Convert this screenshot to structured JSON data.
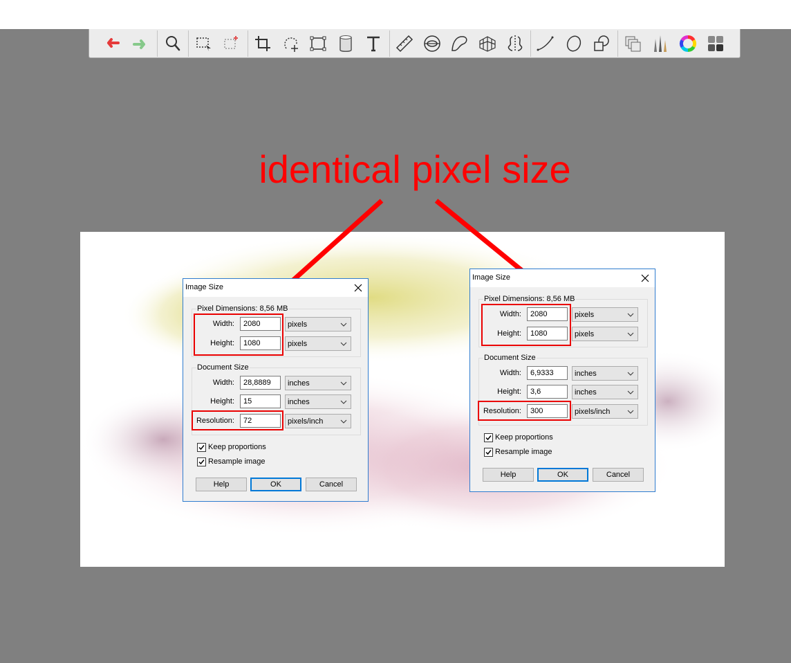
{
  "toolbar": {
    "tools": [
      {
        "icon": "undo-arrow-icon",
        "color": "#e53a3a"
      },
      {
        "icon": "redo-arrow-icon",
        "color": "#86c98a"
      },
      {
        "icon": "zoom-magnifier-icon"
      },
      {
        "icon": "rectangle-selection-icon"
      },
      {
        "icon": "magic-selection-icon"
      },
      {
        "icon": "crop-icon"
      },
      {
        "icon": "lasso-transform-icon"
      },
      {
        "icon": "perspective-transform-icon"
      },
      {
        "icon": "bucket-fill-icon"
      },
      {
        "icon": "text-tool-icon"
      },
      {
        "icon": "ruler-icon"
      },
      {
        "icon": "ellipse-guide-icon"
      },
      {
        "icon": "french-curve-icon"
      },
      {
        "icon": "perspective-grid-icon"
      },
      {
        "icon": "symmetry-icon"
      },
      {
        "icon": "line-stroke-icon"
      },
      {
        "icon": "ellipse-stroke-icon"
      },
      {
        "icon": "shape-tool-icon"
      },
      {
        "icon": "layers-icon"
      },
      {
        "icon": "brushes-icon"
      },
      {
        "icon": "color-wheel-icon"
      },
      {
        "icon": "swatches-icon"
      }
    ]
  },
  "annotation": {
    "text": "identical pixel size",
    "color": "#ff0000"
  },
  "dialogs": [
    {
      "title": "Image Size",
      "pixel_dimensions_label": "Pixel Dimensions: 8,56 MB",
      "width_label": "Width:",
      "height_label": "Height:",
      "pixel_width": "2080",
      "pixel_height": "1080",
      "pixel_width_unit": "pixels",
      "pixel_height_unit": "pixels",
      "document_size_label": "Document Size",
      "doc_width": "28,8889",
      "doc_height": "15",
      "doc_width_unit": "inches",
      "doc_height_unit": "inches",
      "resolution_label": "Resolution:",
      "resolution": "72",
      "resolution_unit": "pixels/inch",
      "keep_proportions": "Keep proportions",
      "resample_image": "Resample image",
      "help": "Help",
      "ok": "OK",
      "cancel": "Cancel"
    },
    {
      "title": "Image Size",
      "pixel_dimensions_label": "Pixel Dimensions: 8,56 MB",
      "width_label": "Width:",
      "height_label": "Height:",
      "pixel_width": "2080",
      "pixel_height": "1080",
      "pixel_width_unit": "pixels",
      "pixel_height_unit": "pixels",
      "document_size_label": "Document Size",
      "doc_width": "6,9333",
      "doc_height": "3,6",
      "doc_width_unit": "inches",
      "doc_height_unit": "inches",
      "resolution_label": "Resolution:",
      "resolution": "300",
      "resolution_unit": "pixels/inch",
      "keep_proportions": "Keep proportions",
      "resample_image": "Resample image",
      "help": "Help",
      "ok": "OK",
      "cancel": "Cancel"
    }
  ]
}
